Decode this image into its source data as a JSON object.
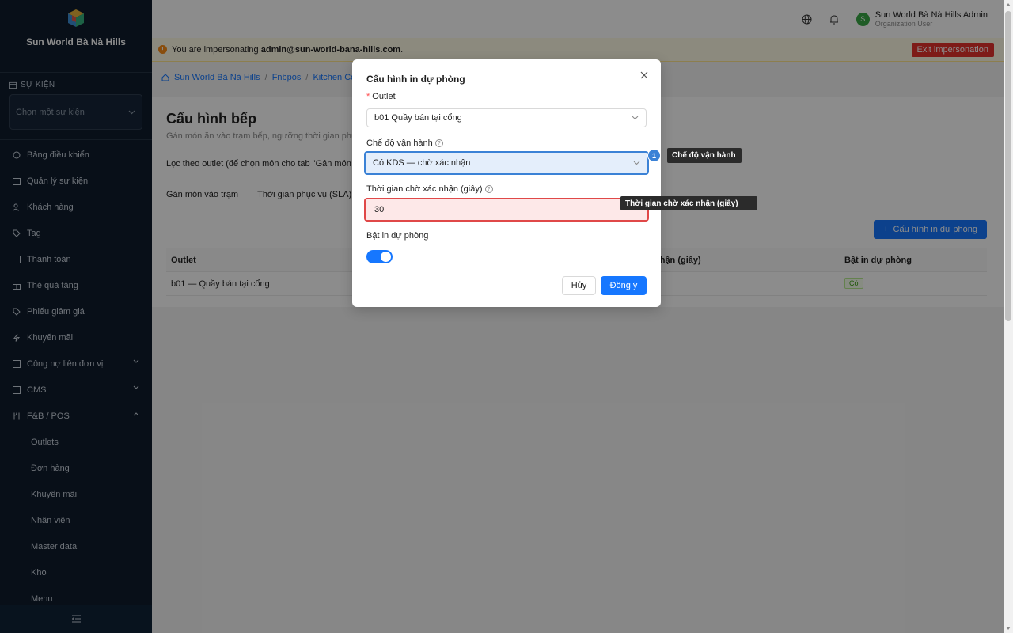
{
  "sidebar": {
    "brand_name": "Sun World Bà Nà Hills",
    "brand_sub": "",
    "event_section_label": "SỰ KIỆN",
    "event_select_placeholder": "Chọn một sự kiện",
    "items": [
      {
        "label": "Bảng điều khiển",
        "icon": "dashboard-icon"
      },
      {
        "label": "Quản lý sự kiện",
        "icon": "calendar-icon"
      },
      {
        "label": "Khách hàng",
        "icon": "users-icon"
      },
      {
        "label": "Tag",
        "icon": "tag-icon"
      },
      {
        "label": "Thanh toán",
        "icon": "payment-icon"
      },
      {
        "label": "Thẻ quà tặng",
        "icon": "gift-icon"
      },
      {
        "label": "Phiếu giảm giá",
        "icon": "coupon-icon"
      },
      {
        "label": "Khuyến mãi",
        "icon": "promotion-icon"
      },
      {
        "label": "Công nợ liên đơn vị",
        "icon": "ledger-icon"
      },
      {
        "label": "CMS",
        "icon": "cms-icon"
      },
      {
        "label": "F&B / POS",
        "icon": "fnb-icon"
      }
    ],
    "submenu": [
      "Outlets",
      "Đơn hàng",
      "Khuyến mãi",
      "Nhân viên",
      "Master data",
      "Kho",
      "Menu"
    ]
  },
  "header": {
    "user_name": "Sun World Bà Nà Hills Admin",
    "user_role": "Organization User",
    "avatar_letter": "S"
  },
  "impersonation": {
    "prefix": "You are impersonating",
    "email": "admin@sun-world-bana-hills.com",
    "suffix": ".",
    "exit_label": "Exit impersonation"
  },
  "breadcrumb": [
    "Sun World Bà Nà Hills",
    "Fnbpos",
    "Kitchen Conf"
  ],
  "page": {
    "title": "Cấu hình bếp",
    "description": "Gán món ăn vào trạm bếp, ngưỡng thời gian phục",
    "filter_label": "Lọc theo outlet (để chọn món cho tab \"Gán món và",
    "tabs": [
      "Gán món vào trạm",
      "Thời gian phục vụ (SLA)"
    ],
    "add_button": "Cấu hình in dự phòng"
  },
  "table": {
    "headers": [
      "Outlet",
      "nhận (giây)",
      "Bật in dự phòng"
    ],
    "rows": [
      {
        "outlet": "b01 — Quầy bán tại cổng",
        "backup_print": "Có"
      }
    ]
  },
  "modal": {
    "title": "Cấu hình in dự phòng",
    "outlet_label": "Outlet",
    "outlet_required_mark": "*",
    "outlet_value": "b01 Quầy bán tại cổng",
    "mode_label": "Chế độ vận hành",
    "mode_value": "Có KDS — chờ xác nhận",
    "wait_label": "Thời gian chờ xác nhận (giây)",
    "wait_value": "30",
    "backup_label": "Bật in dự phòng",
    "backup_enabled": true,
    "cancel_label": "Hủy",
    "ok_label": "Đồng ý"
  },
  "annotations": {
    "badge_number": "1",
    "tooltip_mode": "Chế độ vận hành",
    "tooltip_wait": "Thời gian chờ xác nhận (giây)"
  },
  "colors": {
    "primary": "#1677ff",
    "sidebar_bg": "#0f1c2c",
    "exit_button": "#e5322d",
    "highlight_blue": "#3b82d6",
    "highlight_red": "#e04848"
  }
}
